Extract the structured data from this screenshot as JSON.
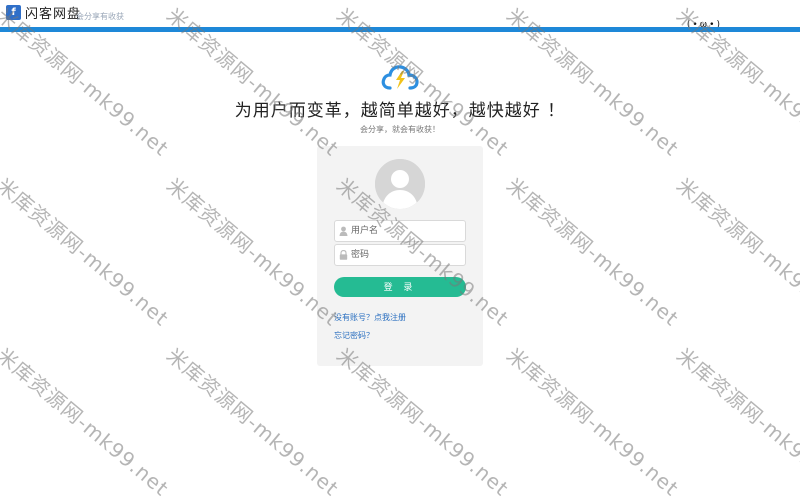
{
  "header": {
    "logo_glyph": "f",
    "brand": "闪客网盘",
    "tagline": "会分享有收获",
    "right_text": "(•ω•)"
  },
  "hero": {
    "title": "为用户而变革，越简单越好，越快越好 ！",
    "subtitle": "会分享，就会有收获！"
  },
  "login": {
    "username_placeholder": "用户名",
    "password_placeholder": "密码",
    "submit_label": "登 录",
    "register_link": "没有账号？点我注册",
    "forgot_link": "忘记密码？"
  },
  "watermark": {
    "text": "米库资源网-mk99.net"
  },
  "colors": {
    "accent": "#1e88d8",
    "button": "#25bb93",
    "link": "#2a6fc0",
    "card": "#f3f3f3"
  }
}
